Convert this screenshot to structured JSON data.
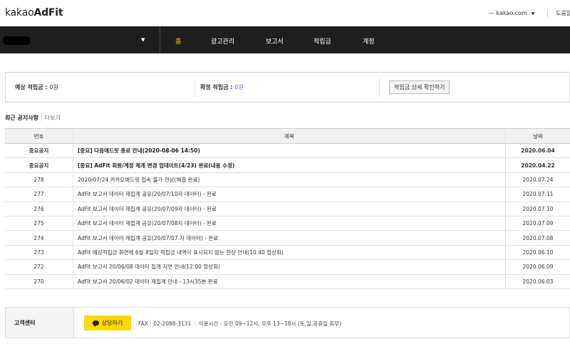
{
  "header": {
    "logo_prefix": "kakao",
    "logo_brand": "AdFit",
    "account": "kakao.com",
    "help": "도움말"
  },
  "nav": {
    "items": [
      {
        "label": "홈",
        "active": true
      },
      {
        "label": "광고관리"
      },
      {
        "label": "보고서"
      },
      {
        "label": "적립금"
      },
      {
        "label": "계정"
      }
    ]
  },
  "summary": {
    "expected_label": "예상 적립금 : ",
    "expected_value": "0원",
    "confirmed_label": "확정 적립금 : ",
    "confirmed_value": "0원",
    "detail_button": "적립금 상세 확인하기"
  },
  "notices": {
    "title": "최근 공지사항",
    "more": "더보기",
    "columns": {
      "no": "번호",
      "title": "제목",
      "date": "날짜"
    },
    "rows": [
      {
        "no": "중요공지",
        "title": "[중요] 다음애드핏 종료 안내(2020-08-06 14:50)",
        "date": "2020.06.04",
        "important": true
      },
      {
        "no": "중요공지",
        "title": "[중요] AdFit 회원/계정 체계 변경 업데이트(4/23) 완료(내용 수정)",
        "date": "2020.04.22",
        "important": true
      },
      {
        "no": "278",
        "title": "2020/07/24 카카오애드핏 접속 불가 현상(해결 완료)",
        "date": "2020.07.24"
      },
      {
        "no": "277",
        "title": "AdFit 보고서 데이터 재집계 공유(20/07/10자 데이터) - 완료",
        "date": "2020.07.11"
      },
      {
        "no": "276",
        "title": "AdFit 보고서 데이터 재집계 공유(20/07/09자 데이터) - 완료",
        "date": "2020.07.10"
      },
      {
        "no": "275",
        "title": "AdFit 보고서 데이터 재집계 공유(20/07/08자 데이터) - 완료",
        "date": "2020.07.09"
      },
      {
        "no": "274",
        "title": "AdFit 보고서 데이터 재집계 공유(20/07/07 자 데이터) - 완료",
        "date": "2020.07.08"
      },
      {
        "no": "273",
        "title": "AdFit 예상적립금 화면에 6월 8일자 적립금 내역이 표시되지 않는 현상 안내(10:40 정상화)",
        "date": "2020.06.10"
      },
      {
        "no": "272",
        "title": "AdFit 보고서 20/06/08 데이터 집계 지연 안내(12:00 정상화)",
        "date": "2020.06.09"
      },
      {
        "no": "270",
        "title": "AdFit 보고서 20/06/02 데이터 재집계 안내 - 13시35분 완료",
        "date": "2020.06.03"
      }
    ]
  },
  "customer_center": {
    "label": "고객센터",
    "consult_button": "상담하기",
    "fax": "FAX : 02-2088-3131",
    "hours": "이용시간 : 오전 09~12시, 오후 13~18시 (토,일,공휴일 휴무)"
  }
}
